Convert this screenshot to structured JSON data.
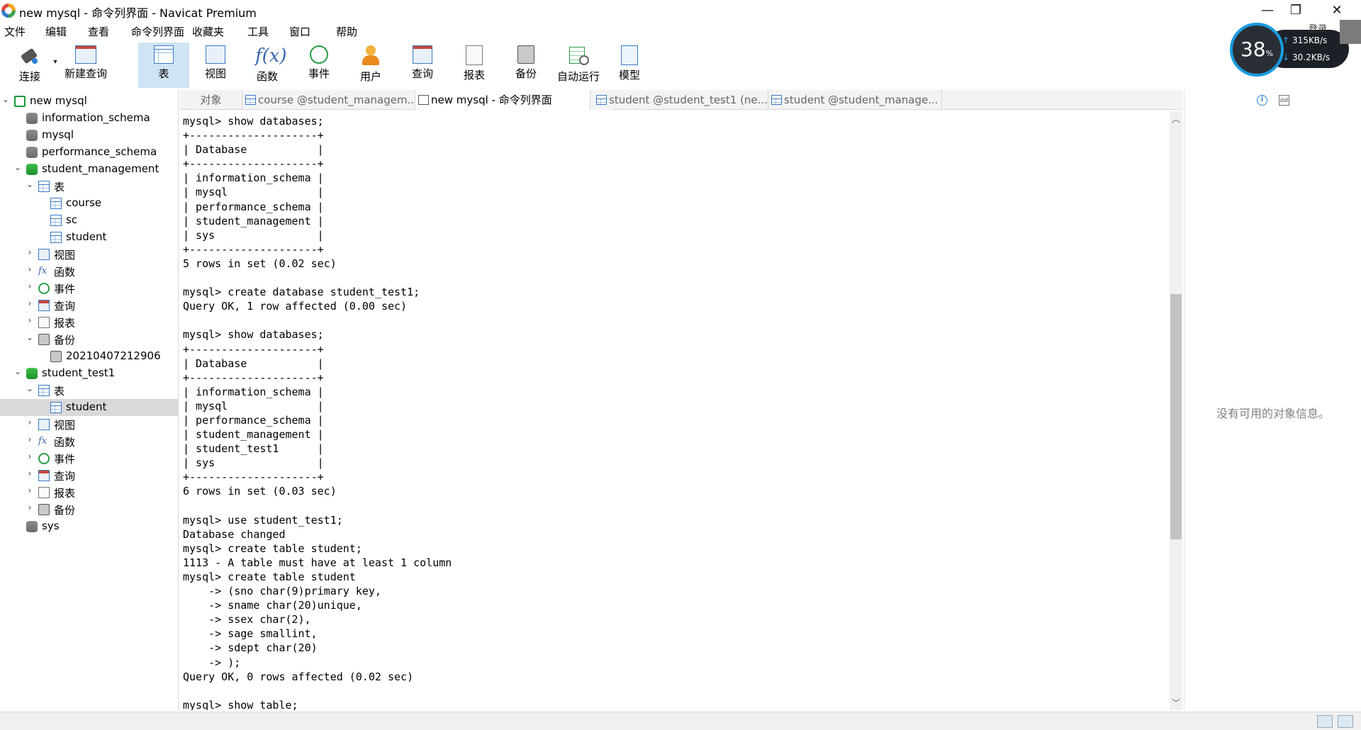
{
  "window": {
    "title": "new mysql - 命令列界面 - Navicat Premium",
    "minimize": "—",
    "maximize": "❐",
    "close": "✕",
    "login": "登录"
  },
  "menu": [
    "文件",
    "编辑",
    "查看",
    "命令列界面",
    "收藏夹",
    "工具",
    "窗口",
    "帮助"
  ],
  "toolbar": {
    "connect": "连接",
    "new_query": "新建查询",
    "table": "表",
    "view": "视图",
    "function": "函数",
    "event": "事件",
    "user": "用户",
    "query": "查询",
    "report": "报表",
    "backup": "备份",
    "automation": "自动运行",
    "model": "模型"
  },
  "net_widget": {
    "percent": "38",
    "percent_unit": "%",
    "upload": "315KB/s",
    "download": "30.2KB/s",
    "up_arrow": "↑",
    "down_arrow": "↓"
  },
  "tree": {
    "items": [
      {
        "label": "new mysql",
        "icon": "connection-icon",
        "chev": "⌄"
      },
      {
        "label": "information_schema",
        "icon": "database-icon",
        "chev": ""
      },
      {
        "label": "mysql",
        "icon": "database-icon",
        "chev": ""
      },
      {
        "label": "performance_schema",
        "icon": "database-icon",
        "chev": ""
      },
      {
        "label": "student_management",
        "icon": "database-open-icon",
        "chev": "⌄"
      },
      {
        "label": "表",
        "icon": "tables-icon",
        "chev": "⌄"
      },
      {
        "label": "course",
        "icon": "table-icon",
        "chev": ""
      },
      {
        "label": "sc",
        "icon": "table-icon",
        "chev": ""
      },
      {
        "label": "student",
        "icon": "table-icon",
        "chev": ""
      },
      {
        "label": "视图",
        "icon": "view-icon",
        "chev": "›"
      },
      {
        "label": "函数",
        "icon": "function-icon",
        "chev": "›"
      },
      {
        "label": "事件",
        "icon": "event-icon",
        "chev": "›"
      },
      {
        "label": "查询",
        "icon": "query-icon",
        "chev": "›"
      },
      {
        "label": "报表",
        "icon": "report-icon",
        "chev": "›"
      },
      {
        "label": "备份",
        "icon": "backup-icon",
        "chev": "⌄"
      },
      {
        "label": "20210407212906",
        "icon": "backup-file-icon",
        "chev": ""
      },
      {
        "label": "student_test1",
        "icon": "database-open-icon",
        "chev": "⌄"
      },
      {
        "label": "表",
        "icon": "tables-icon",
        "chev": "⌄"
      },
      {
        "label": "student",
        "icon": "table-icon",
        "chev": ""
      },
      {
        "label": "视图",
        "icon": "view-icon",
        "chev": "›"
      },
      {
        "label": "函数",
        "icon": "function-icon",
        "chev": "›"
      },
      {
        "label": "事件",
        "icon": "event-icon",
        "chev": "›"
      },
      {
        "label": "查询",
        "icon": "query-icon",
        "chev": "›"
      },
      {
        "label": "报表",
        "icon": "report-icon",
        "chev": "›"
      },
      {
        "label": "备份",
        "icon": "backup-icon",
        "chev": "›"
      },
      {
        "label": "sys",
        "icon": "database-icon",
        "chev": ""
      }
    ]
  },
  "tabs": {
    "objects": "对象",
    "tab1": "course @student_managem...",
    "tab2": "new mysql - 命令列界面",
    "tab3": "student @student_test1 (ne...",
    "tab4": "student @student_manage..."
  },
  "console": {
    "lines": [
      "mysql> show databases;",
      "+--------------------+",
      "| Database           |",
      "+--------------------+",
      "| information_schema |",
      "| mysql              |",
      "| performance_schema |",
      "| student_management |",
      "| sys                |",
      "+--------------------+",
      "5 rows in set (0.02 sec)",
      "",
      "mysql> create database student_test1;",
      "Query OK, 1 row affected (0.00 sec)",
      "",
      "mysql> show databases;",
      "+--------------------+",
      "| Database           |",
      "+--------------------+",
      "| information_schema |",
      "| mysql              |",
      "| performance_schema |",
      "| student_management |",
      "| student_test1      |",
      "| sys                |",
      "+--------------------+",
      "6 rows in set (0.03 sec)",
      "",
      "mysql> use student_test1;",
      "Database changed",
      "mysql> create table student;",
      "1113 - A table must have at least 1 column",
      "mysql> create table student",
      "    -> (sno char(9)primary key,",
      "    -> sname char(20)unique,",
      "    -> ssex char(2),",
      "    -> sage smallint,",
      "    -> sdept char(20)",
      "    -> );",
      "Query OK, 0 rows affected (0.02 sec)",
      "",
      "mysql> show table;"
    ]
  },
  "info_panel": {
    "empty_message": "没有可用的对象信息。"
  }
}
